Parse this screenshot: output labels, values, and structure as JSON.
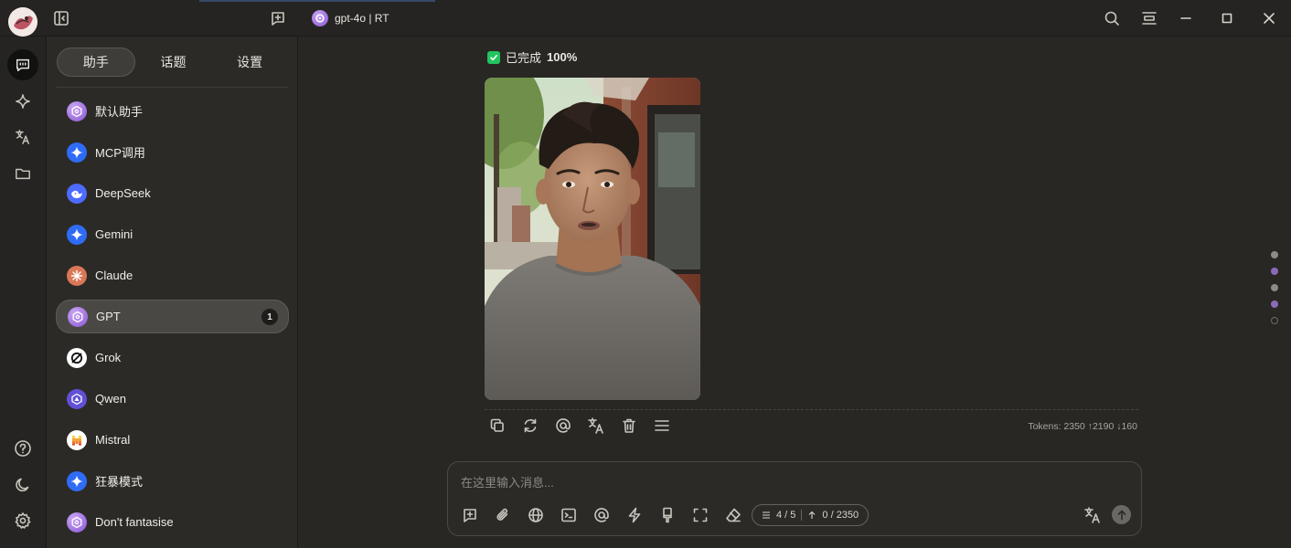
{
  "titlebar": {
    "model_label": "gpt-4o | RT"
  },
  "sidebar": {
    "tabs": [
      {
        "label": "助手",
        "active": true
      },
      {
        "label": "话题",
        "active": false
      },
      {
        "label": "设置",
        "active": false
      }
    ],
    "assistants": [
      {
        "label": "默认助手",
        "icon": "openai-icon"
      },
      {
        "label": "MCP调用",
        "icon": "sparkle-icon"
      },
      {
        "label": "DeepSeek",
        "icon": "deepseek-icon"
      },
      {
        "label": " Gemini",
        "icon": "sparkle-icon"
      },
      {
        "label": "Claude",
        "icon": "claude-icon"
      },
      {
        "label": "GPT",
        "icon": "openai-icon",
        "badge": "1",
        "active": true
      },
      {
        "label": "Grok",
        "icon": "grok-icon"
      },
      {
        "label": "Qwen",
        "icon": "qwen-icon"
      },
      {
        "label": "Mistral",
        "icon": "mistral-icon"
      },
      {
        "label": "狂暴模式",
        "icon": "sparkle-icon"
      },
      {
        "label": "Don't fantasise",
        "icon": "openai-icon"
      }
    ]
  },
  "message": {
    "status_label": "已完成",
    "status_percent": "100%",
    "image_alt": "selfie-photo",
    "tokens": "Tokens: 2350 ↑2190 ↓160"
  },
  "input": {
    "placeholder": "在这里输入消息...",
    "value": "",
    "context_count": "4 / 5",
    "token_count": "0 / 2350"
  },
  "colors": {
    "background": "#282724",
    "sidebar": "#2b2a27",
    "accent_purple": "#8b57d6",
    "success_green": "#22c55e",
    "gemini_blue": "#2f6cf5"
  }
}
